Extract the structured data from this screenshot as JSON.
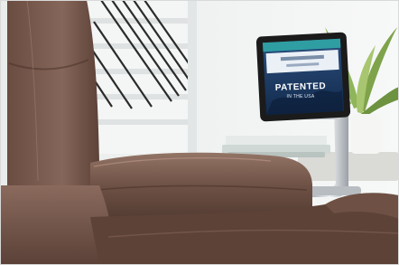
{
  "photo": {
    "subject": "brown leather recliner with tablet holder arm attached to armrest",
    "tablet": {
      "screen_text": "PATENTED",
      "screen_subtext": "IN THE USA",
      "accent_color": "#2f9ea3"
    },
    "colors": {
      "leather": "#6b4f44",
      "leather_highlight": "#8a6a5d",
      "wall": "#f2f3f3",
      "stair_rail": "#2b2b2b",
      "plant": "#7ea34a",
      "tablet_frame": "#1b1b1b",
      "tablet_screen": "#1f3e6b",
      "mount": "#cfd2d6"
    }
  }
}
